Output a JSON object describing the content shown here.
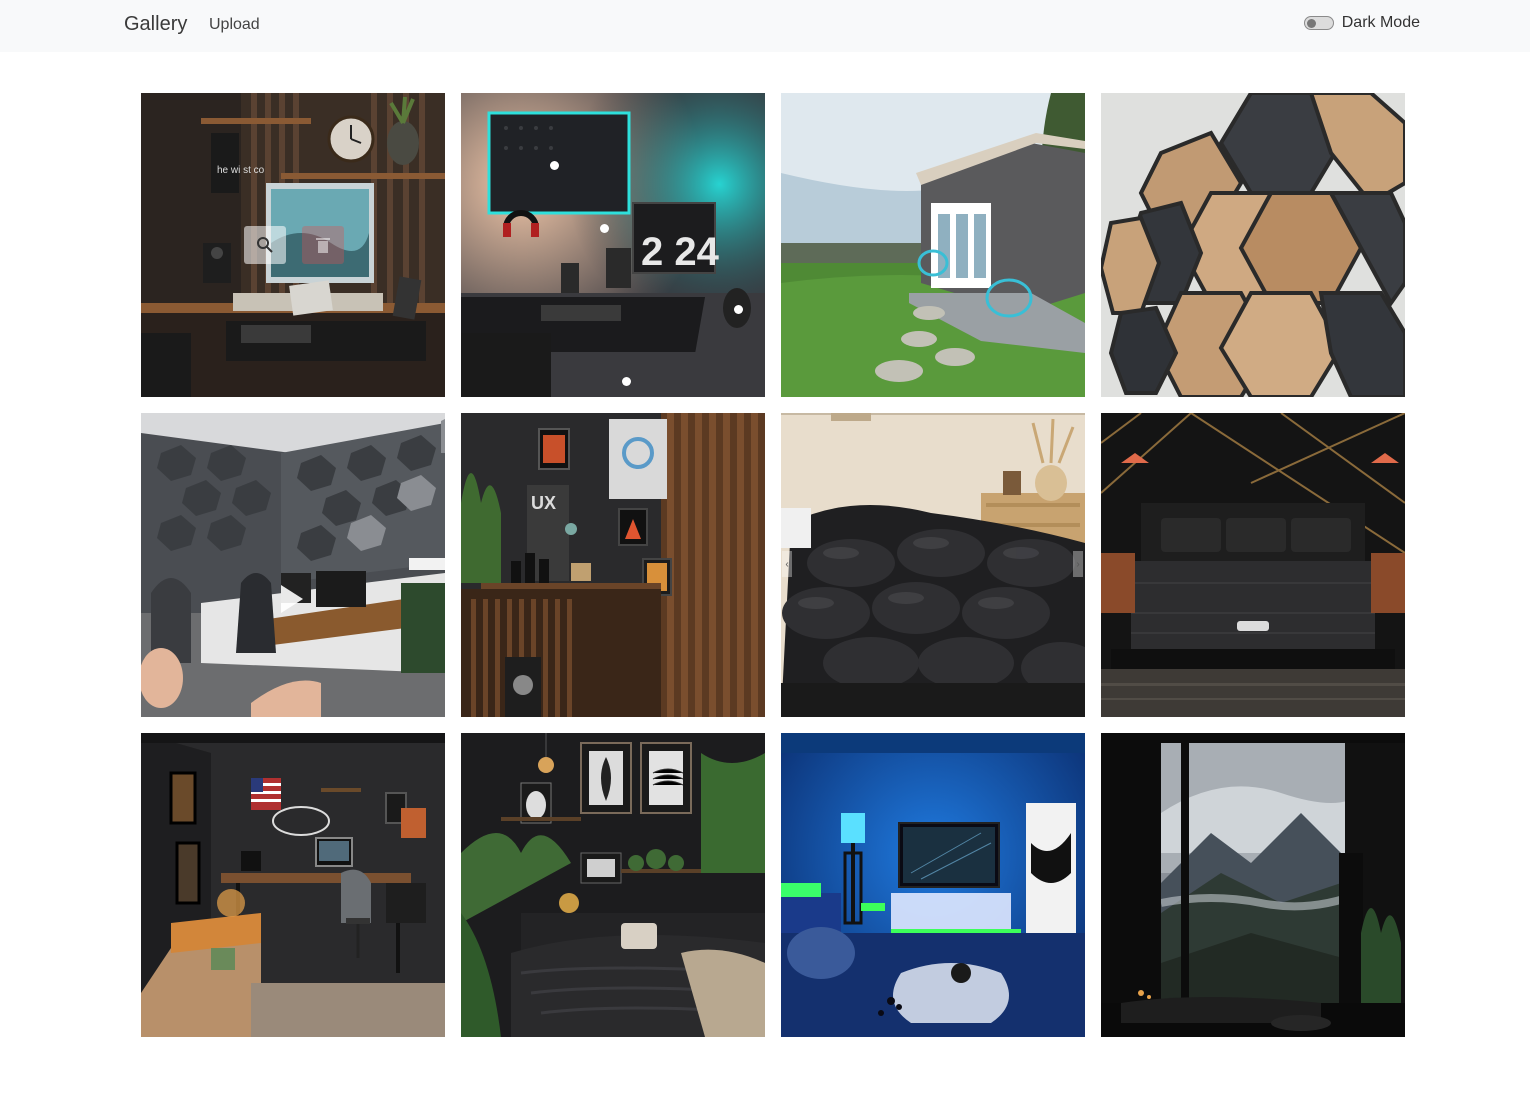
{
  "navbar": {
    "brand": "Gallery",
    "links": [
      "Upload"
    ],
    "dark_mode_label": "Dark Mode"
  },
  "gallery": {
    "images": [
      {
        "name": "desk-setup-slat-wall"
      },
      {
        "name": "desk-setup-teal-led"
      },
      {
        "name": "backyard-studio-shed"
      },
      {
        "name": "hexagon-wood-wall-tiles"
      },
      {
        "name": "hexagon-acoustic-panels-room"
      },
      {
        "name": "slat-wall-shelf-ux"
      },
      {
        "name": "black-down-comforter"
      },
      {
        "name": "black-mattress-bedroom"
      },
      {
        "name": "dark-office-room"
      },
      {
        "name": "dark-bedroom-plants"
      },
      {
        "name": "blue-led-living-room"
      },
      {
        "name": "mountain-view-lounge"
      }
    ]
  },
  "tile_texts": {
    "clock_text": "2 24",
    "ux_sign": "UX",
    "wall_text": "he wi st co"
  }
}
